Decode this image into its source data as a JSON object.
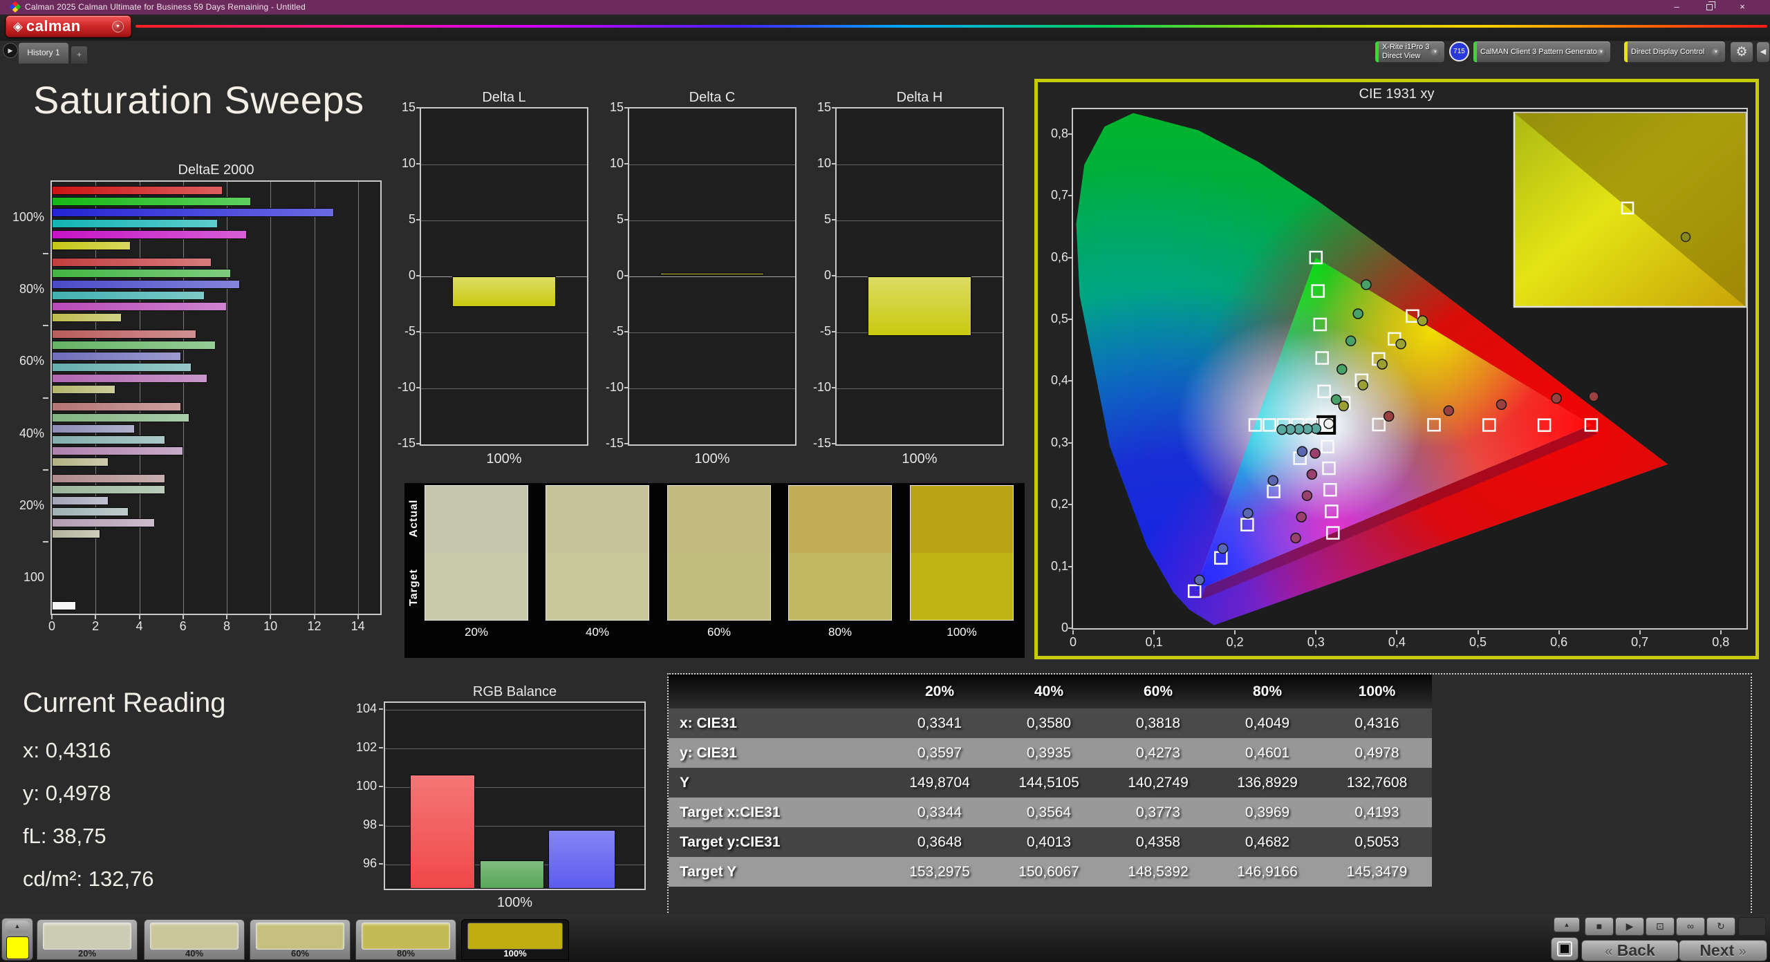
{
  "window": {
    "title": "Calman 2025 Calman Ultimate for Business 59 Days Remaining  - Untitled",
    "minimize": "–",
    "close": "×"
  },
  "header": {
    "logo_text": "calman",
    "history_tab": "History 1",
    "add_tab": "+",
    "meters": [
      {
        "lines": [
          "X-Rite i1Pro 3",
          "Direct View"
        ],
        "strip_color": "#3ed43e",
        "badge": "715"
      },
      {
        "lines": [
          "CalMAN Client 3 Pattern Generator"
        ],
        "strip_color": "#3ed43e"
      },
      {
        "lines": [
          "Direct Display Control"
        ],
        "strip_color": "#e6e600"
      }
    ],
    "gear_icon": "⚙",
    "collapse_icon": "◀"
  },
  "page_title": "Saturation Sweeps",
  "current_reading": {
    "title": "Current Reading",
    "lines": [
      "x: 0,4316",
      "y: 0,4978",
      "fL: 38,75",
      "cd/m²: 132,76"
    ]
  },
  "chart_data": [
    {
      "id": "deltae2000",
      "type": "bar",
      "orientation": "horizontal",
      "title": "DeltaE 2000",
      "xlim": [
        0,
        15
      ],
      "xticks": [
        "0",
        "2",
        "4",
        "6",
        "8",
        "10",
        "12",
        "14"
      ],
      "series_order": [
        "red",
        "green",
        "blue",
        "cyan",
        "magenta",
        "yellow"
      ],
      "groups": [
        {
          "label": "100%",
          "values": [
            7.8,
            9.1,
            12.9,
            7.6,
            8.9,
            3.6
          ],
          "colors": [
            "#cc1414",
            "#14b814",
            "#2424d4",
            "#12b4b4",
            "#c414c4",
            "#c6c616"
          ]
        },
        {
          "label": "80%",
          "values": [
            7.3,
            8.2,
            8.6,
            7.0,
            8.0,
            3.2
          ],
          "colors": [
            "#c23e3e",
            "#42b542",
            "#4a4ac8",
            "#42b0b0",
            "#b84ab8",
            "#bcbc4e"
          ]
        },
        {
          "label": "60%",
          "values": [
            6.6,
            7.5,
            5.9,
            6.4,
            7.1,
            2.9
          ],
          "colors": [
            "#ba5c5c",
            "#64b464",
            "#6e6eba",
            "#66aeae",
            "#b066b0",
            "#b4b46a"
          ]
        },
        {
          "label": "40%",
          "values": [
            5.9,
            6.3,
            3.8,
            5.2,
            6.0,
            2.6
          ],
          "colors": [
            "#b47474",
            "#80b480",
            "#8c8cb6",
            "#84aeae",
            "#ae82ae",
            "#b2b284"
          ]
        },
        {
          "label": "20%",
          "values": [
            5.2,
            5.2,
            2.6,
            3.5,
            4.7,
            2.2
          ],
          "colors": [
            "#ae8a8a",
            "#9ab49a",
            "#a4a4b8",
            "#a0b2b2",
            "#b29cb2",
            "#b4b49c"
          ]
        },
        {
          "label": "100",
          "values": [
            1.1
          ],
          "colors": [
            "#f5f5f5"
          ],
          "slot": 5
        }
      ]
    },
    {
      "id": "delta_l",
      "type": "bar",
      "title": "Delta L",
      "ylim": [
        -15,
        15
      ],
      "yticks": [
        "15",
        "10",
        "5",
        "0",
        "-5",
        "-10",
        "-15"
      ],
      "categories": [
        "100%"
      ],
      "values": [
        -2.7
      ],
      "bar_color": "#c9c910"
    },
    {
      "id": "delta_c",
      "type": "bar",
      "title": "Delta C",
      "ylim": [
        -15,
        15
      ],
      "yticks": [
        "15",
        "10",
        "5",
        "0",
        "-5",
        "-10",
        "-15"
      ],
      "categories": [
        "100%"
      ],
      "values": [
        0.2
      ],
      "bar_color": "#c9c910"
    },
    {
      "id": "delta_h",
      "type": "bar",
      "title": "Delta H",
      "ylim": [
        -15,
        15
      ],
      "yticks": [
        "15",
        "10",
        "5",
        "0",
        "-5",
        "-10",
        "-15"
      ],
      "categories": [
        "100%"
      ],
      "values": [
        -5.3
      ],
      "bar_color": "#c9c910"
    },
    {
      "id": "rgb_balance",
      "type": "bar",
      "title": "RGB Balance",
      "xlabel": "100%",
      "ylim": [
        94.75,
        104.85
      ],
      "yticks": [
        "104",
        "102",
        "100",
        "98",
        "96"
      ],
      "series": [
        {
          "name": "Red",
          "value": 100.65,
          "color": "#f04848"
        },
        {
          "name": "Green",
          "value": 96.2,
          "color": "#57a657"
        },
        {
          "name": "Blue",
          "value": 97.8,
          "color": "#5c5cf0"
        }
      ]
    },
    {
      "id": "cie1931",
      "type": "scatter",
      "title": "CIE 1931 xy",
      "xlim": [
        0,
        0.832
      ],
      "ylim": [
        0,
        0.84
      ],
      "xticks": [
        "0",
        "0,1",
        "0,2",
        "0,3",
        "0,4",
        "0,5",
        "0,6",
        "0,7",
        "0,8"
      ],
      "yticks": [
        "0,8",
        "0,7",
        "0,6",
        "0,5",
        "0,4",
        "0,3",
        "0,2",
        "0,1",
        "0"
      ],
      "series": [
        {
          "name": "white",
          "color": "#f2f2f2",
          "boxed": true,
          "targets": [
            [
              0.3127,
              0.329
            ]
          ],
          "measured": [
            [
              0.316,
              0.331
            ]
          ]
        },
        {
          "name": "red",
          "color": "#9a4040",
          "targets": [
            [
              0.3776,
              0.3295
            ],
            [
              0.4458,
              0.3292
            ],
            [
              0.5139,
              0.3289
            ],
            [
              0.5821,
              0.3286
            ],
            [
              0.64,
              0.329
            ]
          ],
          "measured": [
            [
              0.39,
              0.343
            ],
            [
              0.464,
              0.352
            ],
            [
              0.529,
              0.362
            ],
            [
              0.597,
              0.372
            ],
            [
              0.643,
              0.375
            ]
          ]
        },
        {
          "name": "green",
          "color": "#48a268",
          "targets": [
            [
              0.3102,
              0.3832
            ],
            [
              0.3076,
              0.4374
            ],
            [
              0.3051,
              0.4916
            ],
            [
              0.3025,
              0.5458
            ],
            [
              0.3,
              0.6
            ]
          ],
          "measured": [
            [
              0.325,
              0.37
            ],
            [
              0.332,
              0.419
            ],
            [
              0.343,
              0.465
            ],
            [
              0.352,
              0.509
            ],
            [
              0.362,
              0.556
            ]
          ]
        },
        {
          "name": "blue",
          "color": "#5a68b2",
          "targets": [
            [
              0.2802,
              0.2752
            ],
            [
              0.2477,
              0.2214
            ],
            [
              0.2151,
              0.1676
            ],
            [
              0.1826,
              0.1138
            ],
            [
              0.15,
              0.06
            ]
          ],
          "measured": [
            [
              0.283,
              0.286
            ],
            [
              0.247,
              0.239
            ],
            [
              0.216,
              0.186
            ],
            [
              0.185,
              0.129
            ],
            [
              0.156,
              0.078
            ]
          ]
        },
        {
          "name": "cyan",
          "color": "#58a8a0",
          "targets": [
            [
              0.295,
              0.3291
            ],
            [
              0.2775,
              0.3291
            ],
            [
              0.26,
              0.3291
            ],
            [
              0.2425,
              0.329
            ],
            [
              0.225,
              0.329
            ]
          ],
          "measured": [
            [
              0.3,
              0.323
            ],
            [
              0.2895,
              0.3225
            ],
            [
              0.279,
              0.3222
            ],
            [
              0.2685,
              0.3218
            ],
            [
              0.258,
              0.3215
            ]
          ]
        },
        {
          "name": "magenta",
          "color": "#99406e",
          "targets": [
            [
              0.3143,
              0.294
            ],
            [
              0.316,
              0.259
            ],
            [
              0.3176,
              0.2241
            ],
            [
              0.3193,
              0.1891
            ],
            [
              0.3209,
              0.1542
            ]
          ],
          "measured": [
            [
              0.299,
              0.283
            ],
            [
              0.295,
              0.249
            ],
            [
              0.289,
              0.2145
            ],
            [
              0.282,
              0.18
            ],
            [
              0.275,
              0.146
            ]
          ]
        },
        {
          "name": "yellow",
          "color": "#9aa032",
          "targets": [
            [
              0.3344,
              0.3648
            ],
            [
              0.3564,
              0.4013
            ],
            [
              0.3773,
              0.4358
            ],
            [
              0.3969,
              0.4682
            ],
            [
              0.4193,
              0.5053
            ]
          ],
          "measured": [
            [
              0.3341,
              0.3597
            ],
            [
              0.358,
              0.3935
            ],
            [
              0.3818,
              0.4273
            ],
            [
              0.4049,
              0.4601
            ],
            [
              0.4316,
              0.4978
            ]
          ]
        }
      ],
      "inset": {
        "square": [
          0.49,
          0.49
        ],
        "circle": [
          0.74,
          0.64
        ]
      }
    },
    {
      "id": "saturation_swatches",
      "type": "table",
      "row_labels": [
        "Actual",
        "Target"
      ],
      "levels": [
        {
          "label": "20%",
          "actual": "#c6c6ad",
          "target": "#c9c9ab"
        },
        {
          "label": "40%",
          "actual": "#c6c29a",
          "target": "#c9c79c"
        },
        {
          "label": "60%",
          "actual": "#c3bb7d",
          "target": "#c2bf7c"
        },
        {
          "label": "80%",
          "actual": "#c2ad55",
          "target": "#c3b75f"
        },
        {
          "label": "100%",
          "actual": "#b8a414",
          "target": "#c1b414"
        }
      ]
    }
  ],
  "table": {
    "columns": [
      "",
      "20%",
      "40%",
      "60%",
      "80%",
      "100%"
    ],
    "rows": [
      {
        "label": "x: CIE31",
        "values": [
          "0,3341",
          "0,3580",
          "0,3818",
          "0,4049",
          "0,4316"
        ]
      },
      {
        "label": "y: CIE31",
        "values": [
          "0,3597",
          "0,3935",
          "0,4273",
          "0,4601",
          "0,4978"
        ]
      },
      {
        "label": "Y",
        "values": [
          "149,8704",
          "144,5105",
          "140,2749",
          "136,8929",
          "132,7608"
        ]
      },
      {
        "label": "Target x:CIE31",
        "values": [
          "0,3344",
          "0,3564",
          "0,3773",
          "0,3969",
          "0,4193"
        ]
      },
      {
        "label": "Target y:CIE31",
        "values": [
          "0,3648",
          "0,4013",
          "0,4358",
          "0,4682",
          "0,5053"
        ]
      },
      {
        "label": "Target Y",
        "values": [
          "153,2975",
          "150,6067",
          "148,5392",
          "146,9166",
          "145,3479"
        ]
      }
    ],
    "row_colors": [
      "#4a4a4a",
      "#979797",
      "#3f3f3f",
      "#999999",
      "#444444",
      "#9b9b9b"
    ]
  },
  "bottom": {
    "current_patch_color": "#ffff00",
    "patches": [
      {
        "label": "20%",
        "color": "#ccccb4"
      },
      {
        "label": "40%",
        "color": "#c8c69a"
      },
      {
        "label": "60%",
        "color": "#c6c07e"
      },
      {
        "label": "80%",
        "color": "#c3ba55"
      },
      {
        "label": "100%",
        "color": "#c0ae10",
        "selected": true
      }
    ],
    "transport_icons": [
      "stop",
      "play",
      "pattern",
      "continuous",
      "refresh"
    ],
    "back_chevron": "«",
    "back_label": "Back",
    "next_label": "Next",
    "next_chevron": "»"
  }
}
